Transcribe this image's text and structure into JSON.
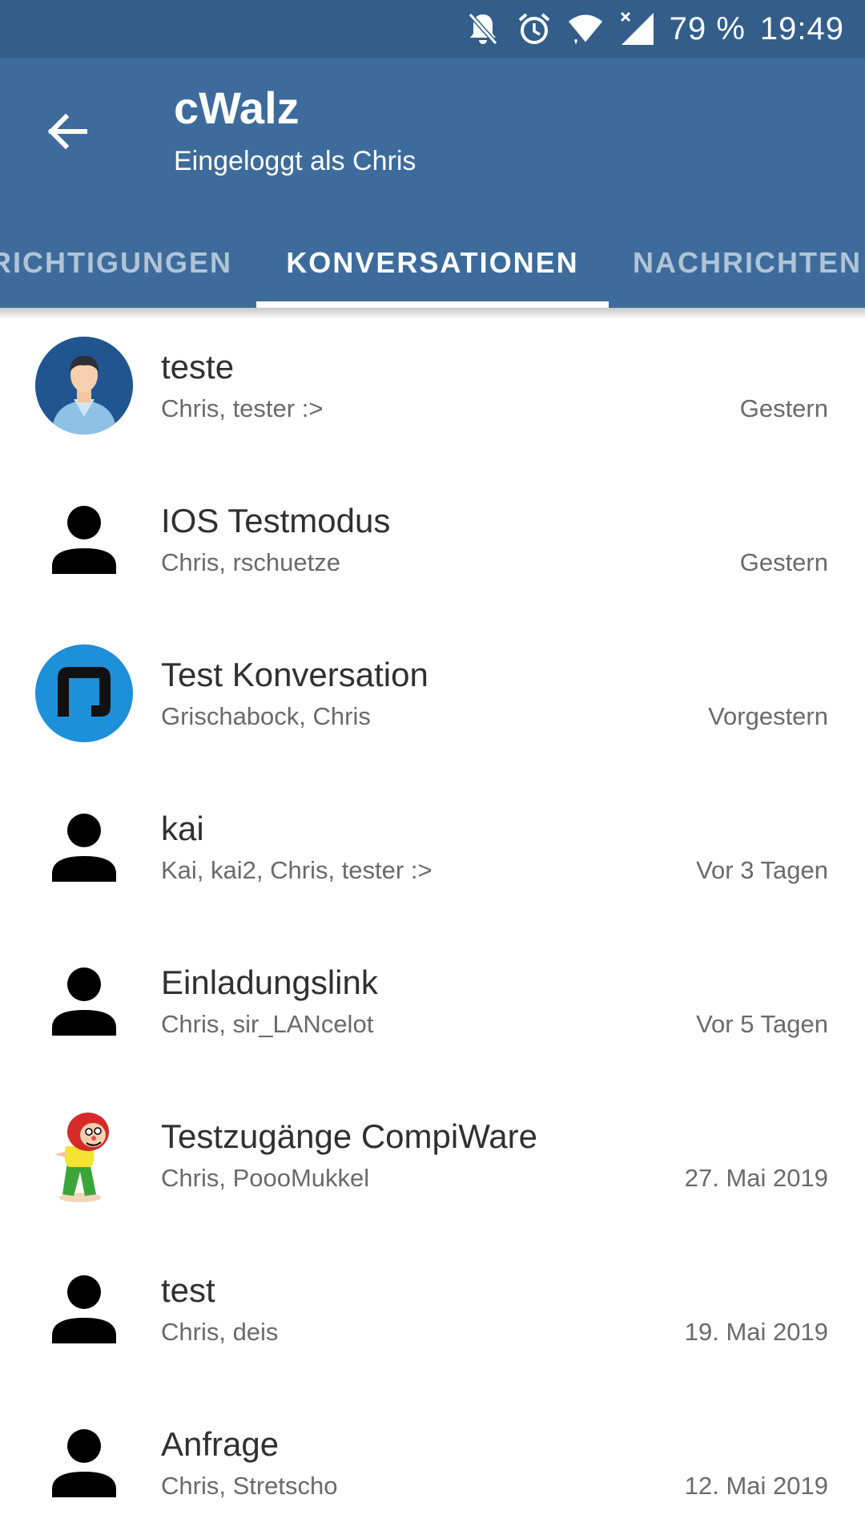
{
  "status_bar": {
    "battery": "79 %",
    "time": "19:49",
    "icons": [
      "notifications-off-icon",
      "alarm-icon",
      "wifi-icon",
      "signal-icon"
    ]
  },
  "app_bar": {
    "title": "cWalz",
    "subtitle": "Eingeloggt als Chris",
    "back_icon": "arrow-back-icon",
    "background_color": "#3d6c9c",
    "status_bar_color": "#335e8a"
  },
  "tabs": [
    {
      "label": "RICHTIGUNGEN",
      "active": false
    },
    {
      "label": "KONVERSATIONEN",
      "active": true
    },
    {
      "label": "NACHRICHTEN",
      "active": false
    }
  ],
  "conversations": [
    {
      "title": "teste",
      "participants": "Chris, tester :>",
      "date": "Gestern",
      "avatar": "male-person-avatar"
    },
    {
      "title": "IOS Testmodus",
      "participants": "Chris, rschuetze",
      "date": "Gestern",
      "avatar": "person-silhouette-icon"
    },
    {
      "title": "Test Konversation",
      "participants": "Grischabock, Chris",
      "date": "Vorgestern",
      "avatar": "blue-logo-avatar"
    },
    {
      "title": "kai",
      "participants": "Kai, kai2, Chris, tester :>",
      "date": "Vor 3 Tagen",
      "avatar": "person-silhouette-icon"
    },
    {
      "title": "Einladungslink",
      "participants": "Chris, sir_LANcelot",
      "date": "Vor 5 Tagen",
      "avatar": "person-silhouette-icon"
    },
    {
      "title": "Testzugänge CompiWare",
      "participants": "Chris, PoooMukkel",
      "date": "27. Mai 2019",
      "avatar": "cartoon-character-avatar"
    },
    {
      "title": "test",
      "participants": "Chris, deis",
      "date": "19. Mai 2019",
      "avatar": "person-silhouette-icon"
    },
    {
      "title": "Anfrage",
      "participants": "Chris, Stretscho",
      "date": "12. Mai 2019",
      "avatar": "person-silhouette-icon"
    }
  ]
}
